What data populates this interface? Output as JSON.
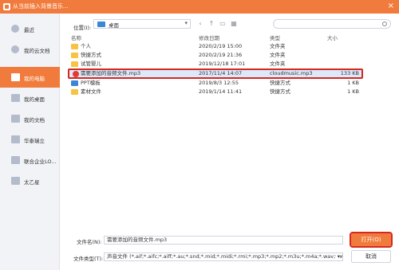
{
  "window": {
    "title": "从当前插入背景音乐...",
    "close_glyph": "×"
  },
  "sidebar": {
    "items": [
      {
        "label": "最近",
        "icon": "clock-icon",
        "active": false
      },
      {
        "label": "我的云文档",
        "icon": "cloud-icon",
        "active": false
      },
      {
        "label": "我的电脑",
        "icon": "computer-icon",
        "active": true
      },
      {
        "label": "我的桌面",
        "icon": "desktop-icon",
        "active": false
      },
      {
        "label": "我的文档",
        "icon": "document-icon",
        "active": false
      },
      {
        "label": "华泰瑞立",
        "icon": "team-icon",
        "active": false
      },
      {
        "label": "联合企业LO...",
        "icon": "team-icon",
        "active": false
      },
      {
        "label": "太乙星",
        "icon": "team-icon",
        "active": false
      }
    ]
  },
  "toolbar": {
    "location_label": "位置(I):",
    "location_value": "桌面",
    "search_placeholder": ""
  },
  "columns": {
    "name": "名称",
    "modified": "修改日期",
    "type": "类型",
    "size": "大小"
  },
  "files": [
    {
      "name": "个人",
      "modified": "2020/2/19 15:00",
      "type": "文件夹",
      "size": "",
      "icon": "folder-icon"
    },
    {
      "name": "快捷方式",
      "modified": "2020/2/19 21:36",
      "type": "文件夹",
      "size": "",
      "icon": "folder-icon"
    },
    {
      "name": "试管婴儿",
      "modified": "2019/12/18 17:01",
      "type": "文件夹",
      "size": "",
      "icon": "folder-icon"
    },
    {
      "name": "需要添加的音频文件.mp3",
      "modified": "2017/11/4 14:07",
      "type": "cloudmusic.mp3",
      "size": "133 KB",
      "icon": "mp3-icon"
    },
    {
      "name": "PPT模板",
      "modified": "2019/8/3 12:55",
      "type": "快捷方式",
      "size": "1 KB",
      "icon": "shortcut-icon"
    },
    {
      "name": "素材文件",
      "modified": "2019/1/14 11:41",
      "type": "快捷方式",
      "size": "1 KB",
      "icon": "shortcut-icon"
    }
  ],
  "footer": {
    "filename_label": "文件名(N):",
    "filename_value": "需要添加的音频文件.mp3",
    "filetype_label": "文件类型(T):",
    "filetype_value": "声音文件 (*.aif;*.aifc;*.aiff;*.au;*.snd;*.mid;*.midi;*.rmi;*.mp3;*.mp2;*.m3u;*.m4a;*.wav;*.wma;*.wax)",
    "open_label": "打开(O)",
    "cancel_label": "取消"
  }
}
